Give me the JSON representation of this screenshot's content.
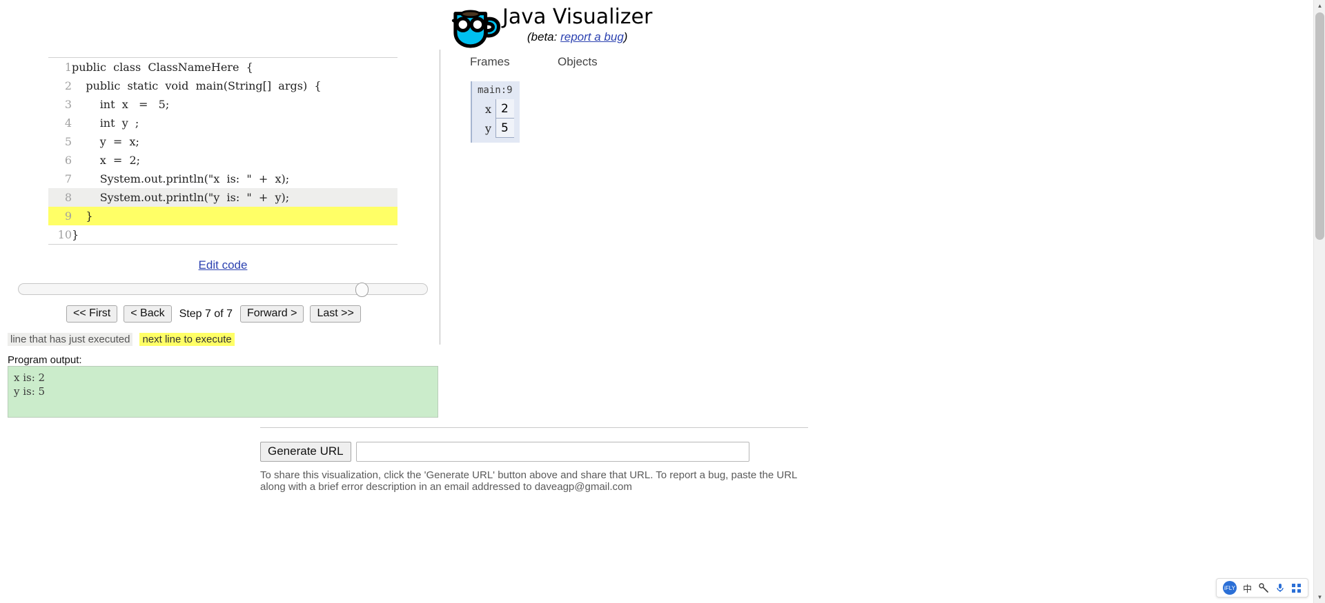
{
  "header": {
    "logo_icon": "java-coffee-cup-glasses-logo",
    "title": "Java Visualizer",
    "beta_prefix": "(beta:",
    "report_bug_link": "report a bug",
    "beta_suffix": ")"
  },
  "code": {
    "lines": [
      {
        "n": "1",
        "text": "public  class  ClassNameHere  {",
        "state": "normal"
      },
      {
        "n": "2",
        "text": "    public  static  void  main(String[]  args)  {",
        "state": "normal"
      },
      {
        "n": "3",
        "text": "        int  x   =   5;",
        "state": "normal"
      },
      {
        "n": "4",
        "text": "        int  y  ;",
        "state": "normal"
      },
      {
        "n": "5",
        "text": "        y  =  x;",
        "state": "normal"
      },
      {
        "n": "6",
        "text": "        x  =  2;",
        "state": "normal"
      },
      {
        "n": "7",
        "text": "        System.out.println(\"x  is:  \"  +  x);",
        "state": "normal"
      },
      {
        "n": "8",
        "text": "        System.out.println(\"y  is:  \"  +  y);",
        "state": "just-executed"
      },
      {
        "n": "9",
        "text": "    }",
        "state": "next-line"
      },
      {
        "n": "10",
        "text": "}",
        "state": "normal"
      }
    ],
    "edit_code_label": "Edit code"
  },
  "controls": {
    "first_label": "<< First",
    "back_label": "< Back",
    "step_label": "Step 7 of 7",
    "forward_label": "Forward >",
    "last_label": "Last >>",
    "slider_position_percent": 85
  },
  "legend": {
    "just_executed": "line that has just executed",
    "next_line": "next line to execute",
    "just_executed_color": "#eeeeec",
    "next_line_color": "#ffff66"
  },
  "program_output": {
    "label": "Program output:",
    "text": "x is: 2\ny is: 5",
    "background_color": "#cbeccb"
  },
  "visualization": {
    "frames_heading": "Frames",
    "objects_heading": "Objects",
    "frames": [
      {
        "title": "main:9",
        "variables": [
          {
            "name": "x",
            "value": "2"
          },
          {
            "name": "y",
            "value": "5"
          }
        ]
      }
    ],
    "objects": []
  },
  "share": {
    "generate_url_label": "Generate URL",
    "url_value": "",
    "url_placeholder": "",
    "help_text": "To share this visualization, click the 'Generate URL' button above and share that URL. To report a bug, paste the URL along with a brief error description in an email addressed to daveagp@gmail.com"
  },
  "ime_bar": {
    "logo_text": "iFLY",
    "lang_label": "中",
    "tools_icon": "tools-icon",
    "mic_icon": "microphone-icon",
    "grid_icon": "grid-menu-icon"
  }
}
